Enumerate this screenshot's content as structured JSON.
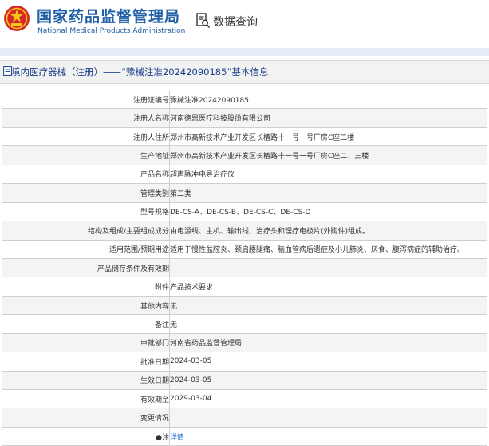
{
  "header": {
    "brand_cn": "国家药品监督管理局",
    "brand_en": "National Medical Products Administration",
    "query_label": "数据查询"
  },
  "breadcrumb": "境内医疗器械（注册）——“豫械注准20242090185”基本信息",
  "fields": [
    {
      "label": "注册证编号",
      "value": "豫械注准20242090185"
    },
    {
      "label": "注册人名称",
      "value": "河南德恩医疗科技股份有限公司"
    },
    {
      "label": "注册人住所",
      "value": "郑州市高新技术产业开发区长椿路十一号一号厂房C座二楼"
    },
    {
      "label": "生产地址",
      "value": "郑州市高新技术产业开发区长椿路十一号一号厂房C座二、三楼"
    },
    {
      "label": "产品名称",
      "value": "超声脉冲电导治疗仪"
    },
    {
      "label": "管理类别",
      "value": "第二类"
    },
    {
      "label": "型号规格",
      "value": "DE-CS-A、DE-CS-B、DE-CS-C、DE-CS-D"
    },
    {
      "label": "结构及组成/主要组成成分",
      "value": "由电源线、主机、输出线、治疗头和理疗电极片(外购件)组成。"
    },
    {
      "label": "适用范围/预期用途",
      "value": "适用于慢性盆腔炎、颈肩腰腿痛、脑血管病后遗症及小儿肺炎、厌食、腹泻病症的辅助治疗。"
    },
    {
      "label": "产品储存条件及有效期",
      "value": ""
    },
    {
      "label": "附件",
      "value": "产品技术要求"
    },
    {
      "label": "其他内容",
      "value": "无"
    },
    {
      "label": "备注",
      "value": "无"
    },
    {
      "label": "审批部门",
      "value": "河南省药品监督管理局"
    },
    {
      "label": "批准日期",
      "value": "2024-03-05"
    },
    {
      "label": "生效日期",
      "value": "2024-03-05"
    },
    {
      "label": "有效期至",
      "value": "2029-03-04"
    },
    {
      "label": "变更情况",
      "value": ""
    }
  ],
  "note": {
    "label": "●注",
    "link": "详情"
  },
  "colors": {
    "brand": "#1f5fa6",
    "breadcrumb": "#1a3f8a",
    "link": "#2a6fd6",
    "emblem": "#d7282a"
  }
}
